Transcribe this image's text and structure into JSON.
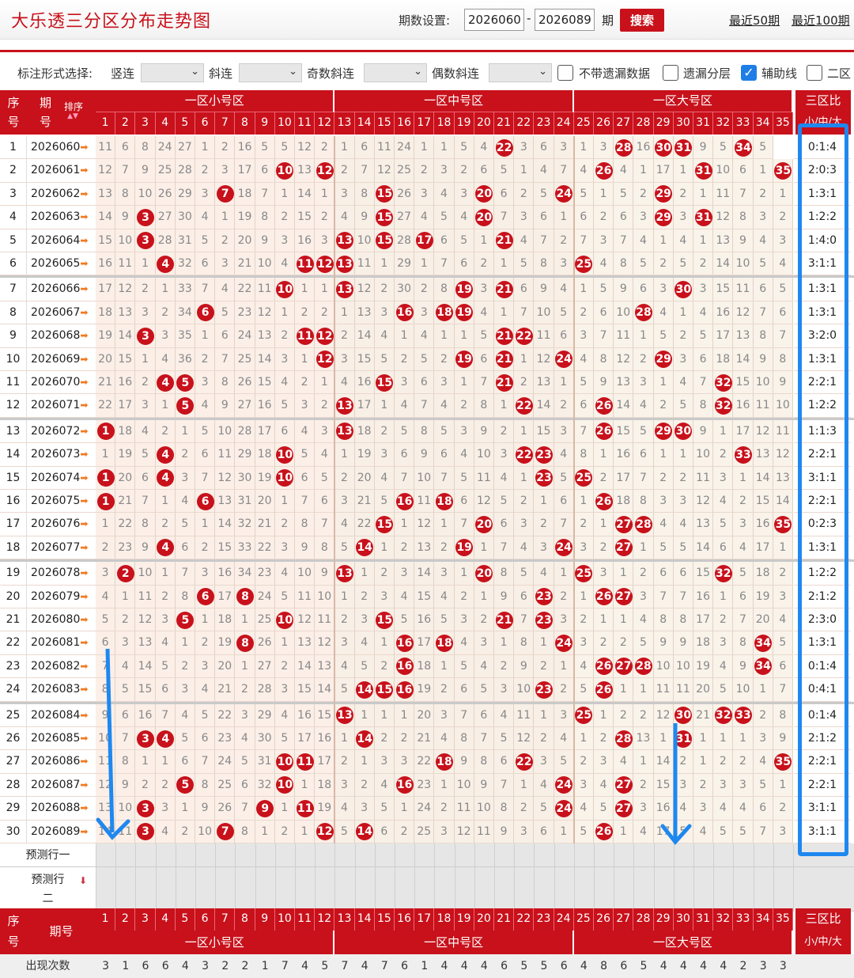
{
  "header": {
    "title": "大乐透三分区分布走势图",
    "period_label": "期数设置:",
    "period_start": "2026060",
    "period_end": "2026089",
    "period_unit": "期",
    "search_label": "搜索",
    "link_50": "最近50期",
    "link_100": "最近100期"
  },
  "options": {
    "mark_label": "标注形式选择:",
    "vertical": "竖连",
    "diagonal": "斜连",
    "odd_diag": "奇数斜连",
    "even_diag": "偶数斜连",
    "no_missing": "不带遗漏数据",
    "missing_layer": "遗漏分层",
    "aux_line": "辅助线",
    "zone2": "二区"
  },
  "table": {
    "col_seq": "序号",
    "col_period": "期号",
    "sort_label": "排序",
    "zone_small": "一区小号区",
    "zone_mid": "一区中号区",
    "zone_big": "一区大号区",
    "zone_ratio": "三区比",
    "ratio_sub": "小/中/大",
    "predict1": "预测行一",
    "predict2": "预测行二",
    "count_label": "出现次数",
    "numbers": [
      1,
      2,
      3,
      4,
      5,
      6,
      7,
      8,
      9,
      10,
      11,
      12,
      13,
      14,
      15,
      16,
      17,
      18,
      19,
      20,
      21,
      22,
      23,
      24,
      25,
      26,
      27,
      28,
      29,
      30,
      31,
      32,
      33,
      34,
      35
    ],
    "counts": [
      3,
      1,
      6,
      6,
      4,
      3,
      2,
      2,
      1,
      7,
      4,
      5,
      7,
      4,
      7,
      6,
      1,
      4,
      4,
      4,
      6,
      5,
      5,
      6,
      4,
      8,
      6,
      5,
      4,
      4,
      4,
      4,
      2,
      3,
      3
    ],
    "rows": [
      {
        "seq": "1",
        "period": "2026060",
        "ratio": "0:1:4",
        "cells": [
          11,
          6,
          8,
          24,
          27,
          1,
          2,
          16,
          5,
          5,
          12,
          2,
          1,
          6,
          11,
          24,
          1,
          1,
          5,
          4,
          "22",
          3,
          6,
          3,
          1,
          3,
          "28",
          16,
          "30",
          "31",
          9,
          5,
          "34",
          5
        ]
      },
      {
        "seq": "2",
        "period": "2026061",
        "ratio": "2:0:3",
        "cells": [
          12,
          7,
          9,
          25,
          28,
          2,
          3,
          17,
          6,
          "10",
          13,
          "12",
          2,
          7,
          12,
          25,
          2,
          3,
          2,
          6,
          5,
          1,
          4,
          7,
          4,
          "26",
          4,
          1,
          17,
          1,
          "31",
          10,
          6,
          1,
          "35"
        ]
      },
      {
        "seq": "3",
        "period": "2026062",
        "ratio": "1:3:1",
        "cells": [
          13,
          8,
          10,
          26,
          29,
          3,
          "7",
          18,
          7,
          1,
          14,
          1,
          3,
          8,
          "15",
          26,
          3,
          4,
          3,
          "20",
          6,
          2,
          5,
          "24",
          5,
          1,
          5,
          2,
          "29",
          2,
          1,
          11,
          7,
          2,
          1
        ]
      },
      {
        "seq": "4",
        "period": "2026063",
        "ratio": "1:2:2",
        "cells": [
          14,
          9,
          "3",
          27,
          30,
          4,
          1,
          19,
          8,
          2,
          15,
          2,
          4,
          9,
          "15",
          27,
          4,
          5,
          4,
          "20",
          7,
          3,
          6,
          1,
          6,
          2,
          6,
          3,
          "29",
          3,
          "31",
          12,
          8,
          3,
          2
        ]
      },
      {
        "seq": "5",
        "period": "2026064",
        "ratio": "1:4:0",
        "cells": [
          15,
          10,
          "3",
          28,
          31,
          5,
          2,
          20,
          9,
          3,
          16,
          3,
          "13",
          10,
          "15",
          28,
          "17",
          6,
          5,
          1,
          "21",
          4,
          7,
          2,
          7,
          3,
          7,
          4,
          1,
          4,
          1,
          13,
          9,
          4,
          3
        ]
      },
      {
        "seq": "6",
        "period": "2026065",
        "ratio": "3:1:1",
        "cells": [
          16,
          11,
          1,
          "4",
          32,
          6,
          3,
          21,
          10,
          4,
          "11",
          "12",
          "13",
          11,
          1,
          29,
          1,
          7,
          6,
          2,
          1,
          5,
          8,
          3,
          "25",
          4,
          8,
          5,
          2,
          5,
          2,
          14,
          10,
          5,
          4
        ]
      },
      {
        "seq": "7",
        "period": "2026066",
        "ratio": "1:3:1",
        "cells": [
          17,
          12,
          2,
          1,
          33,
          7,
          4,
          22,
          11,
          "10",
          1,
          1,
          "13",
          12,
          2,
          30,
          2,
          8,
          "19",
          3,
          "21",
          6,
          9,
          4,
          1,
          5,
          9,
          6,
          3,
          "30",
          3,
          15,
          11,
          6,
          5
        ]
      },
      {
        "seq": "8",
        "period": "2026067",
        "ratio": "1:3:1",
        "cells": [
          18,
          13,
          3,
          2,
          34,
          "6",
          5,
          23,
          12,
          1,
          2,
          2,
          1,
          13,
          3,
          "16",
          3,
          "18",
          "19",
          4,
          1,
          7,
          10,
          5,
          2,
          6,
          10,
          "28",
          4,
          1,
          4,
          16,
          12,
          7,
          6
        ]
      },
      {
        "seq": "9",
        "period": "2026068",
        "ratio": "3:2:0",
        "cells": [
          19,
          14,
          "3",
          3,
          35,
          1,
          6,
          24,
          13,
          2,
          "11",
          "12",
          2,
          14,
          4,
          1,
          4,
          1,
          1,
          5,
          "21",
          "22",
          11,
          6,
          3,
          7,
          11,
          1,
          5,
          2,
          5,
          17,
          13,
          8,
          7
        ]
      },
      {
        "seq": "10",
        "period": "2026069",
        "ratio": "1:3:1",
        "cells": [
          20,
          15,
          1,
          4,
          36,
          2,
          7,
          25,
          14,
          3,
          1,
          "12",
          3,
          15,
          5,
          2,
          5,
          2,
          "19",
          6,
          "21",
          1,
          12,
          "24",
          4,
          8,
          12,
          2,
          "29",
          3,
          6,
          18,
          14,
          9,
          8
        ]
      },
      {
        "seq": "11",
        "period": "2026070",
        "ratio": "2:2:1",
        "cells": [
          21,
          16,
          2,
          "4",
          "5",
          3,
          8,
          26,
          15,
          4,
          2,
          1,
          4,
          16,
          "15",
          3,
          6,
          3,
          1,
          7,
          "21",
          2,
          13,
          1,
          5,
          9,
          13,
          3,
          1,
          4,
          7,
          "32",
          15,
          10,
          9
        ]
      },
      {
        "seq": "12",
        "period": "2026071",
        "ratio": "1:2:2",
        "cells": [
          22,
          17,
          3,
          1,
          "5",
          4,
          9,
          27,
          16,
          5,
          3,
          2,
          "13",
          17,
          1,
          4,
          7,
          4,
          2,
          8,
          1,
          "22",
          14,
          2,
          6,
          "26",
          14,
          4,
          2,
          5,
          8,
          "32",
          16,
          11,
          10
        ]
      },
      {
        "seq": "13",
        "period": "2026072",
        "ratio": "1:1:3",
        "cells": [
          "1",
          18,
          4,
          2,
          1,
          5,
          10,
          28,
          17,
          6,
          4,
          3,
          "13",
          18,
          2,
          5,
          8,
          5,
          3,
          9,
          2,
          1,
          15,
          3,
          7,
          "26",
          15,
          5,
          "29",
          "30",
          9,
          1,
          17,
          12,
          11
        ]
      },
      {
        "seq": "14",
        "period": "2026073",
        "ratio": "2:2:1",
        "cells": [
          1,
          19,
          5,
          "4",
          2,
          6,
          11,
          29,
          18,
          "10",
          5,
          4,
          1,
          19,
          3,
          6,
          9,
          6,
          4,
          10,
          3,
          "22",
          "23",
          4,
          8,
          1,
          16,
          6,
          1,
          1,
          10,
          2,
          "33",
          13,
          12
        ]
      },
      {
        "seq": "15",
        "period": "2026074",
        "ratio": "3:1:1",
        "cells": [
          "1",
          20,
          6,
          "4",
          3,
          7,
          12,
          30,
          19,
          "10",
          6,
          5,
          2,
          20,
          4,
          7,
          10,
          7,
          5,
          11,
          4,
          1,
          "23",
          5,
          "25",
          2,
          17,
          7,
          2,
          2,
          11,
          3,
          1,
          14,
          13
        ]
      },
      {
        "seq": "16",
        "period": "2026075",
        "ratio": "2:2:1",
        "cells": [
          "1",
          21,
          7,
          1,
          4,
          "6",
          13,
          31,
          20,
          1,
          7,
          6,
          3,
          21,
          5,
          "16",
          11,
          "18",
          6,
          12,
          5,
          2,
          1,
          6,
          1,
          "26",
          18,
          8,
          3,
          3,
          12,
          4,
          2,
          15,
          14
        ]
      },
      {
        "seq": "17",
        "period": "2026076",
        "ratio": "0:2:3",
        "cells": [
          1,
          22,
          8,
          2,
          5,
          1,
          14,
          32,
          21,
          2,
          8,
          7,
          4,
          22,
          "15",
          1,
          12,
          1,
          7,
          "20",
          6,
          3,
          2,
          7,
          2,
          1,
          "27",
          "28",
          4,
          4,
          13,
          5,
          3,
          16,
          "35"
        ]
      },
      {
        "seq": "18",
        "period": "2026077",
        "ratio": "1:3:1",
        "cells": [
          2,
          23,
          9,
          "4",
          6,
          2,
          15,
          33,
          22,
          3,
          9,
          8,
          5,
          "14",
          1,
          2,
          13,
          2,
          "19",
          1,
          7,
          4,
          3,
          "24",
          3,
          2,
          "27",
          1,
          5,
          5,
          14,
          6,
          4,
          17,
          1
        ]
      },
      {
        "seq": "19",
        "period": "2026078",
        "ratio": "1:2:2",
        "cells": [
          3,
          "2",
          10,
          1,
          7,
          3,
          16,
          34,
          23,
          4,
          10,
          9,
          "13",
          1,
          2,
          3,
          14,
          3,
          1,
          "20",
          8,
          5,
          4,
          1,
          "25",
          3,
          1,
          2,
          6,
          6,
          15,
          "32",
          5,
          18,
          2
        ]
      },
      {
        "seq": "20",
        "period": "2026079",
        "ratio": "2:1:2",
        "cells": [
          4,
          1,
          11,
          2,
          8,
          "6",
          17,
          "8",
          24,
          5,
          11,
          10,
          1,
          2,
          3,
          4,
          15,
          4,
          2,
          1,
          9,
          6,
          "23",
          2,
          1,
          "26",
          "27",
          3,
          7,
          7,
          16,
          1,
          6,
          19,
          3
        ]
      },
      {
        "seq": "21",
        "period": "2026080",
        "ratio": "2:3:0",
        "cells": [
          5,
          2,
          12,
          3,
          "5",
          1,
          18,
          1,
          25,
          "10",
          12,
          11,
          2,
          3,
          "15",
          5,
          16,
          5,
          3,
          2,
          "21",
          7,
          "23",
          3,
          2,
          1,
          1,
          4,
          8,
          8,
          17,
          2,
          7,
          20,
          4
        ]
      },
      {
        "seq": "22",
        "period": "2026081",
        "ratio": "1:3:1",
        "cells": [
          6,
          3,
          13,
          4,
          1,
          2,
          19,
          "8",
          26,
          1,
          13,
          12,
          3,
          4,
          1,
          "16",
          17,
          "18",
          4,
          3,
          1,
          8,
          1,
          "24",
          3,
          2,
          2,
          5,
          9,
          9,
          18,
          3,
          8,
          "34",
          5
        ]
      },
      {
        "seq": "23",
        "period": "2026082",
        "ratio": "0:1:4",
        "cells": [
          7,
          4,
          14,
          5,
          2,
          3,
          20,
          1,
          27,
          2,
          14,
          13,
          4,
          5,
          2,
          "16",
          18,
          1,
          5,
          4,
          2,
          9,
          2,
          1,
          4,
          "26",
          "27",
          "28",
          10,
          10,
          19,
          4,
          9,
          "34",
          6
        ]
      },
      {
        "seq": "24",
        "period": "2026083",
        "ratio": "0:4:1",
        "cells": [
          8,
          5,
          15,
          6,
          3,
          4,
          21,
          2,
          28,
          3,
          15,
          14,
          5,
          "14",
          "15",
          "16",
          19,
          2,
          6,
          5,
          3,
          10,
          "23",
          2,
          5,
          "26",
          1,
          1,
          11,
          11,
          20,
          5,
          10,
          1,
          7
        ]
      },
      {
        "seq": "25",
        "period": "2026084",
        "ratio": "0:1:4",
        "cells": [
          9,
          6,
          16,
          7,
          4,
          5,
          22,
          3,
          29,
          4,
          16,
          15,
          "13",
          1,
          1,
          1,
          20,
          3,
          7,
          6,
          4,
          11,
          1,
          3,
          "25",
          1,
          2,
          2,
          12,
          "30",
          21,
          "32",
          "33",
          2,
          8
        ]
      },
      {
        "seq": "26",
        "period": "2026085",
        "ratio": "2:1:2",
        "cells": [
          10,
          7,
          "3",
          "4",
          5,
          6,
          23,
          4,
          30,
          5,
          17,
          16,
          1,
          "14",
          2,
          2,
          21,
          4,
          8,
          7,
          5,
          12,
          2,
          4,
          1,
          2,
          "28",
          13,
          1,
          "31",
          1,
          1,
          1,
          3,
          9
        ]
      },
      {
        "seq": "27",
        "period": "2026086",
        "ratio": "2:2:1",
        "cells": [
          11,
          8,
          1,
          1,
          6,
          7,
          24,
          5,
          31,
          "10",
          "11",
          17,
          2,
          1,
          3,
          3,
          22,
          "18",
          9,
          8,
          6,
          "22",
          3,
          5,
          2,
          3,
          4,
          1,
          14,
          2,
          1,
          2,
          2,
          4,
          "35"
        ]
      },
      {
        "seq": "28",
        "period": "2026087",
        "ratio": "2:2:1",
        "cells": [
          12,
          9,
          2,
          2,
          "5",
          8,
          25,
          6,
          32,
          "10",
          1,
          18,
          3,
          2,
          4,
          "16",
          23,
          1,
          10,
          9,
          7,
          1,
          4,
          "24",
          3,
          4,
          "27",
          2,
          15,
          3,
          2,
          3,
          3,
          5,
          1
        ]
      },
      {
        "seq": "29",
        "period": "2026088",
        "ratio": "3:1:1",
        "cells": [
          13,
          10,
          "3",
          3,
          1,
          9,
          26,
          7,
          "9",
          1,
          "11",
          19,
          4,
          3,
          5,
          1,
          24,
          2,
          11,
          10,
          8,
          2,
          5,
          "24",
          4,
          5,
          "27",
          3,
          16,
          4,
          3,
          4,
          4,
          6,
          2
        ]
      },
      {
        "seq": "30",
        "period": "2026089",
        "ratio": "3:1:1",
        "cells": [
          14,
          11,
          "3",
          4,
          2,
          10,
          "7",
          8,
          1,
          2,
          1,
          "12",
          5,
          "14",
          6,
          2,
          25,
          3,
          12,
          11,
          9,
          3,
          6,
          1,
          5,
          "26",
          1,
          4,
          17,
          5,
          4,
          5,
          5,
          7,
          3
        ]
      }
    ]
  }
}
